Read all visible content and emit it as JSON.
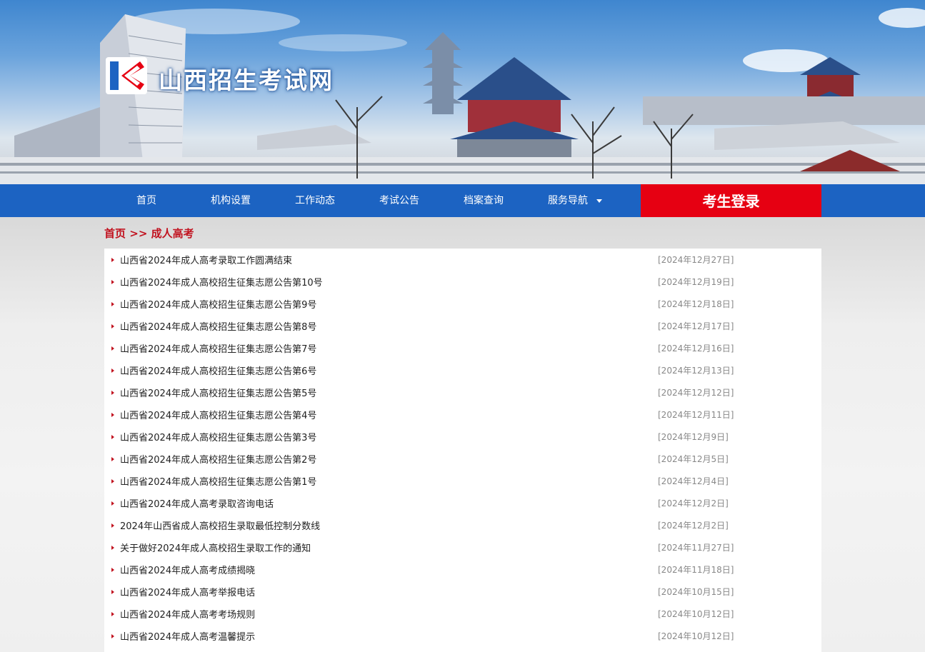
{
  "header": {
    "site_title": "山西招生考试网"
  },
  "nav": {
    "items": [
      "首页",
      "机构设置",
      "工作动态",
      "考试公告",
      "档案查询",
      "服务导航"
    ],
    "login_label": "考生登录"
  },
  "breadcrumb": {
    "home": "首页",
    "separator": ">>",
    "current": "成人高考"
  },
  "colors": {
    "nav_bg": "#1c63c2",
    "login_bg": "#e60012",
    "breadcrumb": "#c1121f"
  },
  "articles": [
    {
      "title": "山西省2024年成人高考录取工作圆满结束",
      "date": "[2024年12月27日]"
    },
    {
      "title": "山西省2024年成人高校招生征集志愿公告第10号",
      "date": "[2024年12月19日]"
    },
    {
      "title": "山西省2024年成人高校招生征集志愿公告第9号",
      "date": "[2024年12月18日]"
    },
    {
      "title": "山西省2024年成人高校招生征集志愿公告第8号",
      "date": "[2024年12月17日]"
    },
    {
      "title": "山西省2024年成人高校招生征集志愿公告第7号",
      "date": "[2024年12月16日]"
    },
    {
      "title": "山西省2024年成人高校招生征集志愿公告第6号",
      "date": "[2024年12月13日]"
    },
    {
      "title": "山西省2024年成人高校招生征集志愿公告第5号",
      "date": "[2024年12月12日]"
    },
    {
      "title": "山西省2024年成人高校招生征集志愿公告第4号",
      "date": "[2024年12月11日]"
    },
    {
      "title": "山西省2024年成人高校招生征集志愿公告第3号",
      "date": "[2024年12月9日]"
    },
    {
      "title": "山西省2024年成人高校招生征集志愿公告第2号",
      "date": "[2024年12月5日]"
    },
    {
      "title": "山西省2024年成人高校招生征集志愿公告第1号",
      "date": "[2024年12月4日]"
    },
    {
      "title": "山西省2024年成人高考录取咨询电话",
      "date": "[2024年12月2日]"
    },
    {
      "title": "2024年山西省成人高校招生录取最低控制分数线",
      "date": "[2024年12月2日]"
    },
    {
      "title": "关于做好2024年成人高校招生录取工作的通知",
      "date": "[2024年11月27日]"
    },
    {
      "title": "山西省2024年成人高考成绩揭晓",
      "date": "[2024年11月18日]"
    },
    {
      "title": "山西省2024年成人高考举报电话",
      "date": "[2024年10月15日]"
    },
    {
      "title": "山西省2024年成人高考考场规则",
      "date": "[2024年10月12日]"
    },
    {
      "title": "山西省2024年成人高考温馨提示",
      "date": "[2024年10月12日]"
    }
  ]
}
